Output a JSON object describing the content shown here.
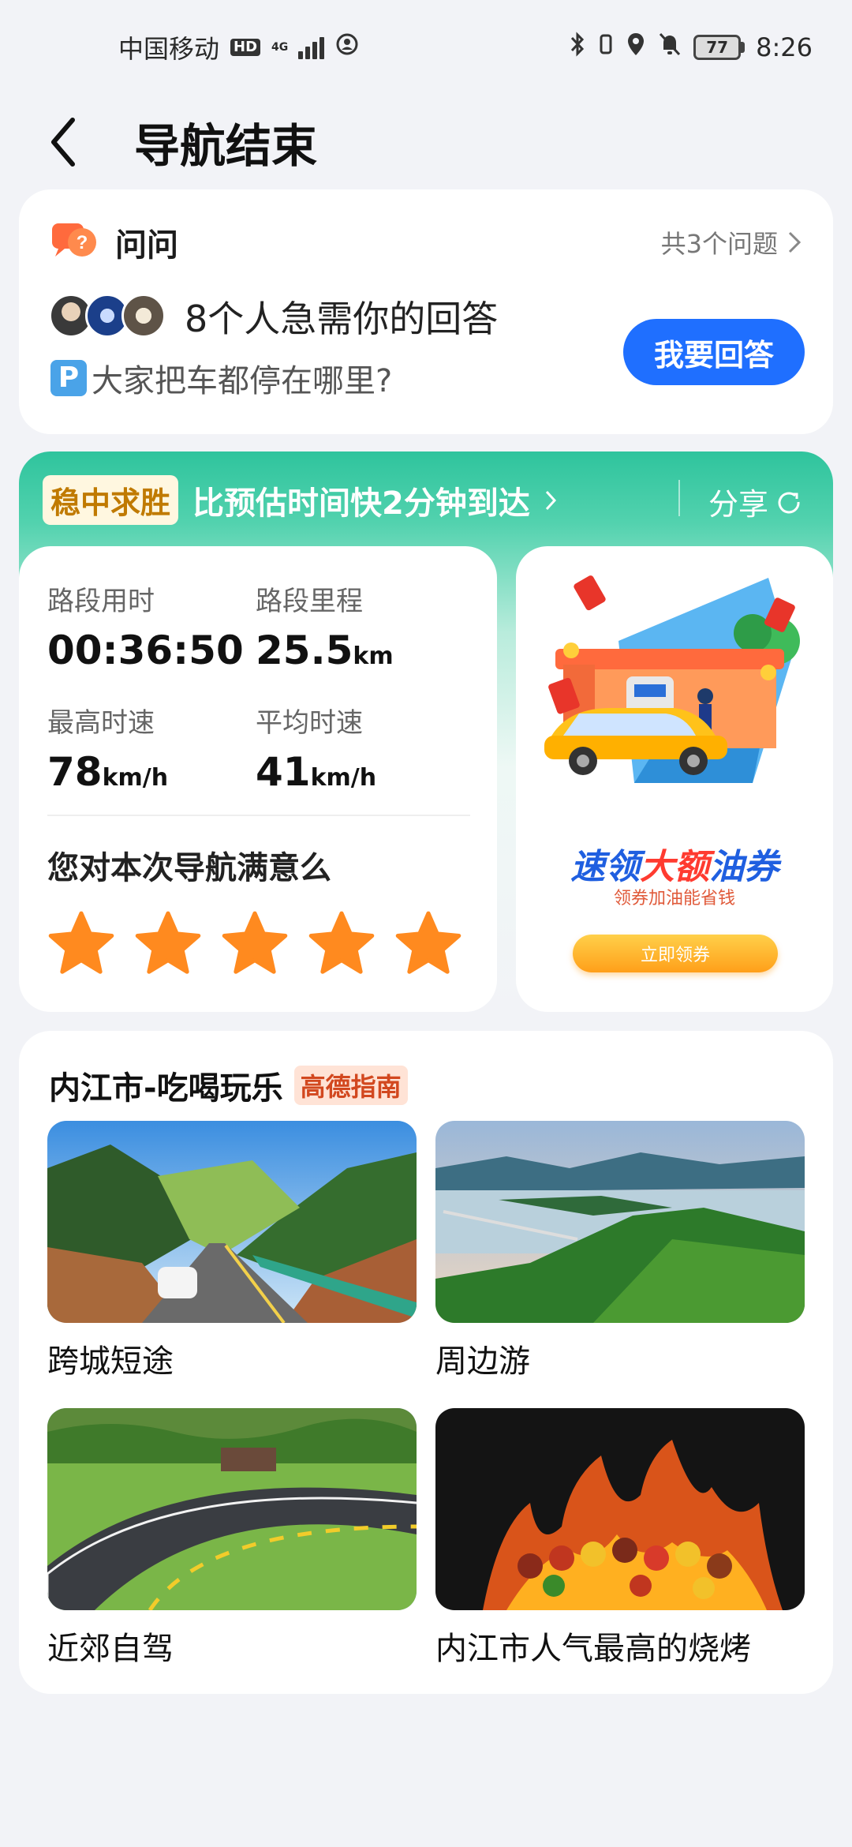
{
  "status_bar": {
    "carrier": "中国移动",
    "hd": "HD",
    "network": "4G",
    "battery": "77",
    "time": "8:26"
  },
  "header": {
    "title": "导航结束"
  },
  "qa": {
    "title": "问问",
    "more": "共3个问题",
    "message": "8个人急需你的回答",
    "question_badge": "P",
    "question": "大家把车都停在哪里?",
    "answer_button": "我要回答"
  },
  "trip": {
    "tag": "稳中求胜",
    "headline": "比预估时间快2分钟到达",
    "share": "分享",
    "stats": [
      {
        "label": "路段用时",
        "value": "00:36:50",
        "unit": ""
      },
      {
        "label": "路段里程",
        "value": "25.5",
        "unit": "km"
      },
      {
        "label": "最高时速",
        "value": "78",
        "unit": "km/h"
      },
      {
        "label": "平均时速",
        "value": "41",
        "unit": "km/h"
      }
    ],
    "rating_question": "您对本次导航满意么",
    "rating_stars": 5
  },
  "ad": {
    "headline_a": "速领",
    "headline_b": "大额",
    "headline_c": "油券",
    "subtitle": "领券加油能省钱",
    "button": "立即领券"
  },
  "guide": {
    "title": "内江市-吃喝玩乐",
    "tag": "高德指南",
    "tiles": [
      {
        "label": "跨城短途"
      },
      {
        "label": "周边游"
      },
      {
        "label": "近郊自驾"
      },
      {
        "label": "内江市人气最高的烧烤"
      }
    ]
  },
  "colors": {
    "accent_blue": "#1f6fff",
    "teal": "#2fc49d",
    "star_orange": "#ff8a1f"
  }
}
